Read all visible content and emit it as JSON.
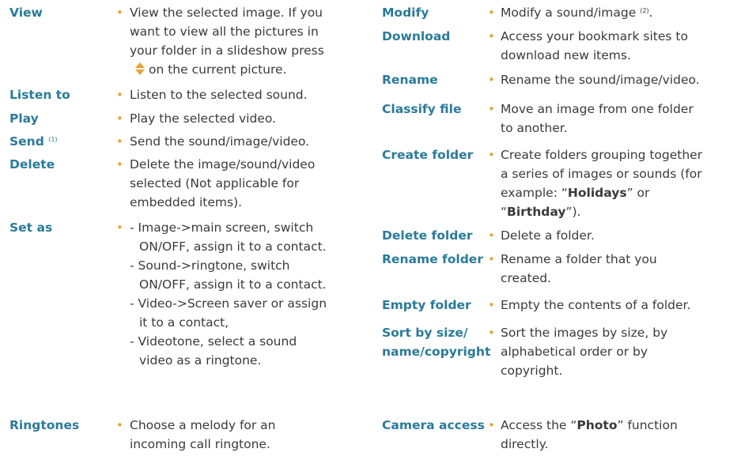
{
  "left": {
    "view": {
      "term": "View",
      "lines": [
        "View the selected image. If you",
        "want to view all the pictures in",
        "your folder in a slideshow press",
        "on the current picture."
      ]
    },
    "listen": {
      "term": "Listen to",
      "lines": [
        "Listen to the selected sound."
      ]
    },
    "play": {
      "term": "Play",
      "lines": [
        "Play the selected video."
      ]
    },
    "send": {
      "term": "Send",
      "sup": "(1)",
      "lines": [
        "Send the sound/image/video."
      ]
    },
    "delete": {
      "term": "Delete",
      "lines": [
        "Delete the image/sound/video",
        "selected (Not applicable for",
        "embedded items)."
      ]
    },
    "setas": {
      "term": "Set as",
      "lines": [
        "- Image->main screen, switch",
        "ON/OFF, assign it to a contact.",
        "- Sound->ringtone, switch",
        "ON/OFF, assign it to a contact.",
        "- Video->Screen saver or assign",
        "it to a contact,",
        "- Videotone, select a sound",
        "video as a ringtone."
      ]
    },
    "ringtones": {
      "term": "Ringtones",
      "lines": [
        "Choose a melody for an",
        "incoming call ringtone."
      ]
    }
  },
  "right": {
    "modify": {
      "term": "Modify",
      "line": "Modify a sound/image",
      "sup": "(2)",
      "tail": "."
    },
    "download": {
      "term": "Download",
      "lines": [
        "Access your bookmark sites to",
        "download new items."
      ]
    },
    "rename": {
      "term": "Rename",
      "lines": [
        "Rename the sound/image/video."
      ]
    },
    "classify": {
      "term": "Classify file",
      "lines": [
        "Move an image from one folder",
        "to another."
      ]
    },
    "create": {
      "term": "Create folder",
      "lines": [
        "Create folders grouping together",
        "a series of images or sounds (for"
      ],
      "line3_pre": "example: “",
      "line3_bold": "Holidays",
      "line3_post": "” or",
      "line4_pre": "“",
      "line4_bold": "Birthday",
      "line4_post": "”)."
    },
    "deletefolder": {
      "term": "Delete folder",
      "lines": [
        "Delete a folder."
      ]
    },
    "renamefolder": {
      "term": "Rename folder",
      "lines": [
        "Rename a folder that you",
        "created."
      ]
    },
    "empty": {
      "term": "Empty folder",
      "lines": [
        "Empty the contents of a folder."
      ]
    },
    "sort": {
      "term1": "Sort by size/",
      "term2": "name/copyright",
      "lines": [
        "Sort the images by size, by",
        "alphabetical order or by",
        "copyright."
      ]
    },
    "camera": {
      "term": "Camera access",
      "pre": "Access the “",
      "bold": "Photo",
      "post": "” function",
      "line2": "directly."
    }
  },
  "bullet": "•",
  "colors": {
    "term": "#2a7a9a",
    "bullet": "#e8a339",
    "text": "#3a3a3a"
  }
}
